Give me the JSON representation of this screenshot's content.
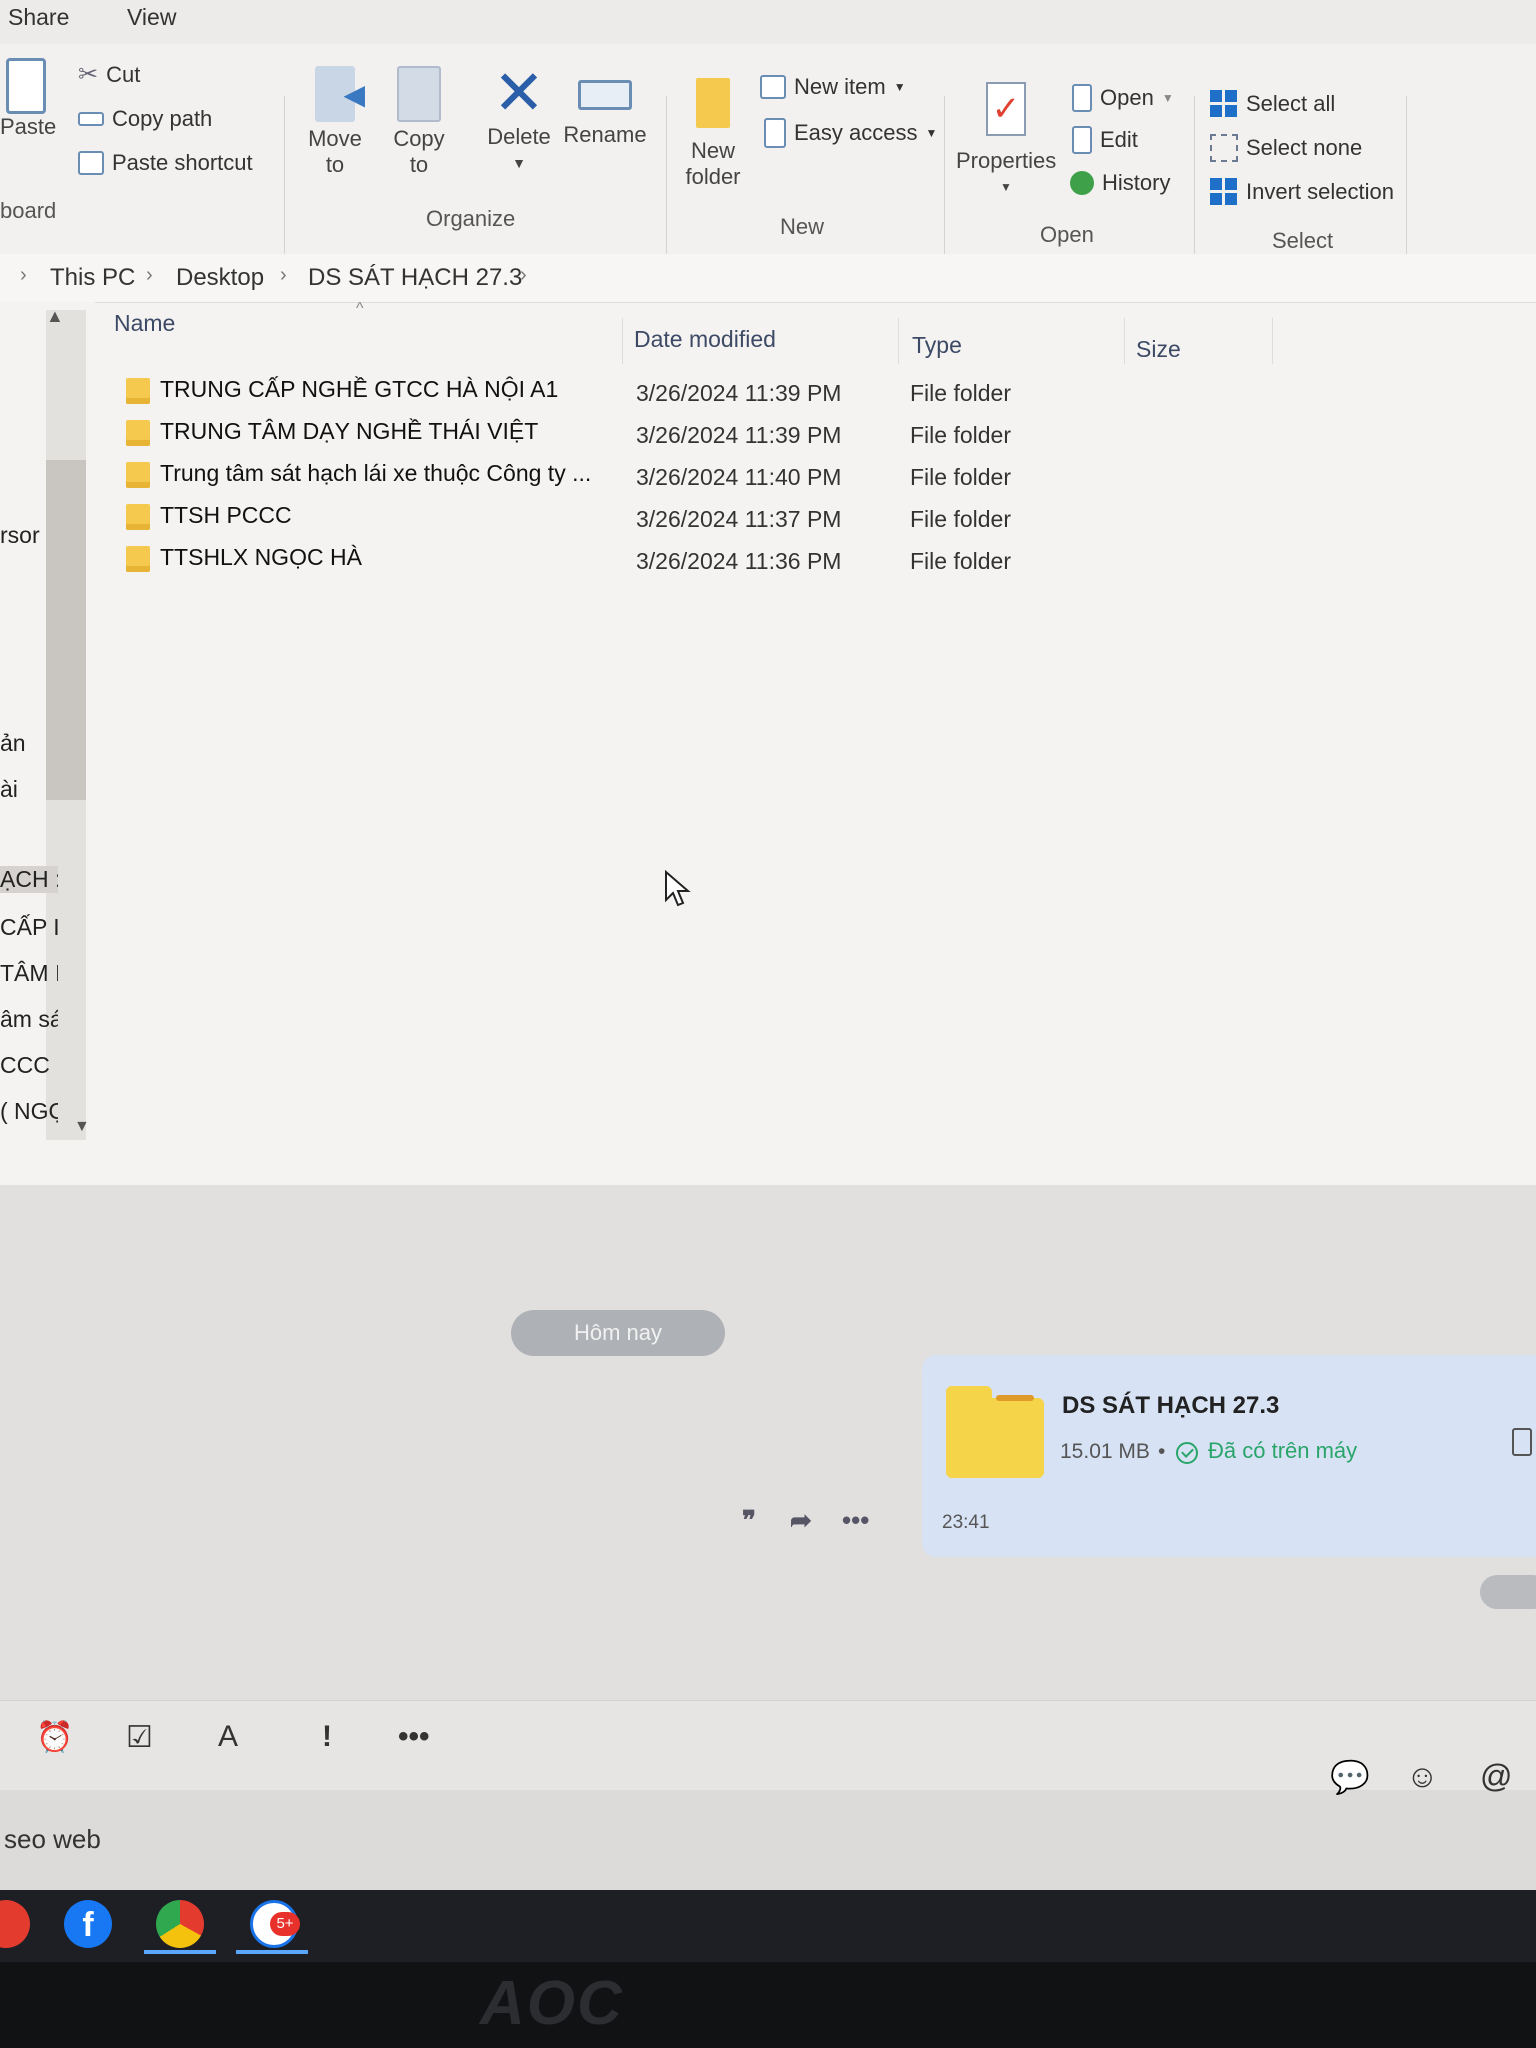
{
  "menu": {
    "share": "Share",
    "view": "View"
  },
  "ribbon": {
    "paste": "Paste",
    "cut": "Cut",
    "copy_path": "Copy path",
    "paste_shortcut": "Paste shortcut",
    "clipboard_group": "board",
    "move_to": "Move",
    "move_to2": "to",
    "copy_to": "Copy",
    "copy_to2": "to",
    "delete": "Delete",
    "rename": "Rename",
    "organize_group": "Organize",
    "new_item": "New item",
    "easy_access": "Easy access",
    "new_folder": "New",
    "new_folder2": "folder",
    "new_group": "New",
    "properties": "Properties",
    "open": "Open",
    "edit": "Edit",
    "history": "History",
    "open_group": "Open",
    "select_all": "Select all",
    "select_none": "Select none",
    "invert_selection": "Invert selection",
    "select_group": "Select"
  },
  "breadcrumb": [
    "This PC",
    "Desktop",
    "DS SÁT HẠCH 27.3"
  ],
  "nav_items": [
    "rsor",
    "ản",
    "ài",
    "",
    "ẠCH :",
    "CẤP I",
    "TÂM I",
    "âm sát",
    "CCC",
    "( NGỌ"
  ],
  "columns": {
    "name": "Name",
    "date": "Date modified",
    "type": "Type",
    "size": "Size"
  },
  "files": [
    {
      "name": "TRUNG CẤP NGHỀ GTCC HÀ NỘI A1",
      "date": "3/26/2024 11:39 PM",
      "type": "File folder"
    },
    {
      "name": "TRUNG TÂM DẠY NGHỀ THÁI VIỆT",
      "date": "3/26/2024 11:39 PM",
      "type": "File folder"
    },
    {
      "name": "Trung tâm sát hạch lái xe thuộc Công ty ...",
      "date": "3/26/2024 11:40 PM",
      "type": "File folder"
    },
    {
      "name": "TTSH PCCC",
      "date": "3/26/2024 11:37 PM",
      "type": "File folder"
    },
    {
      "name": "TTSHLX NGỌC HÀ",
      "date": "3/26/2024 11:36 PM",
      "type": "File folder"
    }
  ],
  "chat": {
    "date_pill": "Hôm nay",
    "file_name": "DS SÁT HẠCH 27.3",
    "file_size": "15.01 MB",
    "dot": "•",
    "status": "Đã có trên máy",
    "time": "23:41"
  },
  "composer": {
    "text": "seo web"
  },
  "taskbar": {
    "zalo_badge": "5+"
  },
  "monitor": {
    "brand": "AOC"
  }
}
